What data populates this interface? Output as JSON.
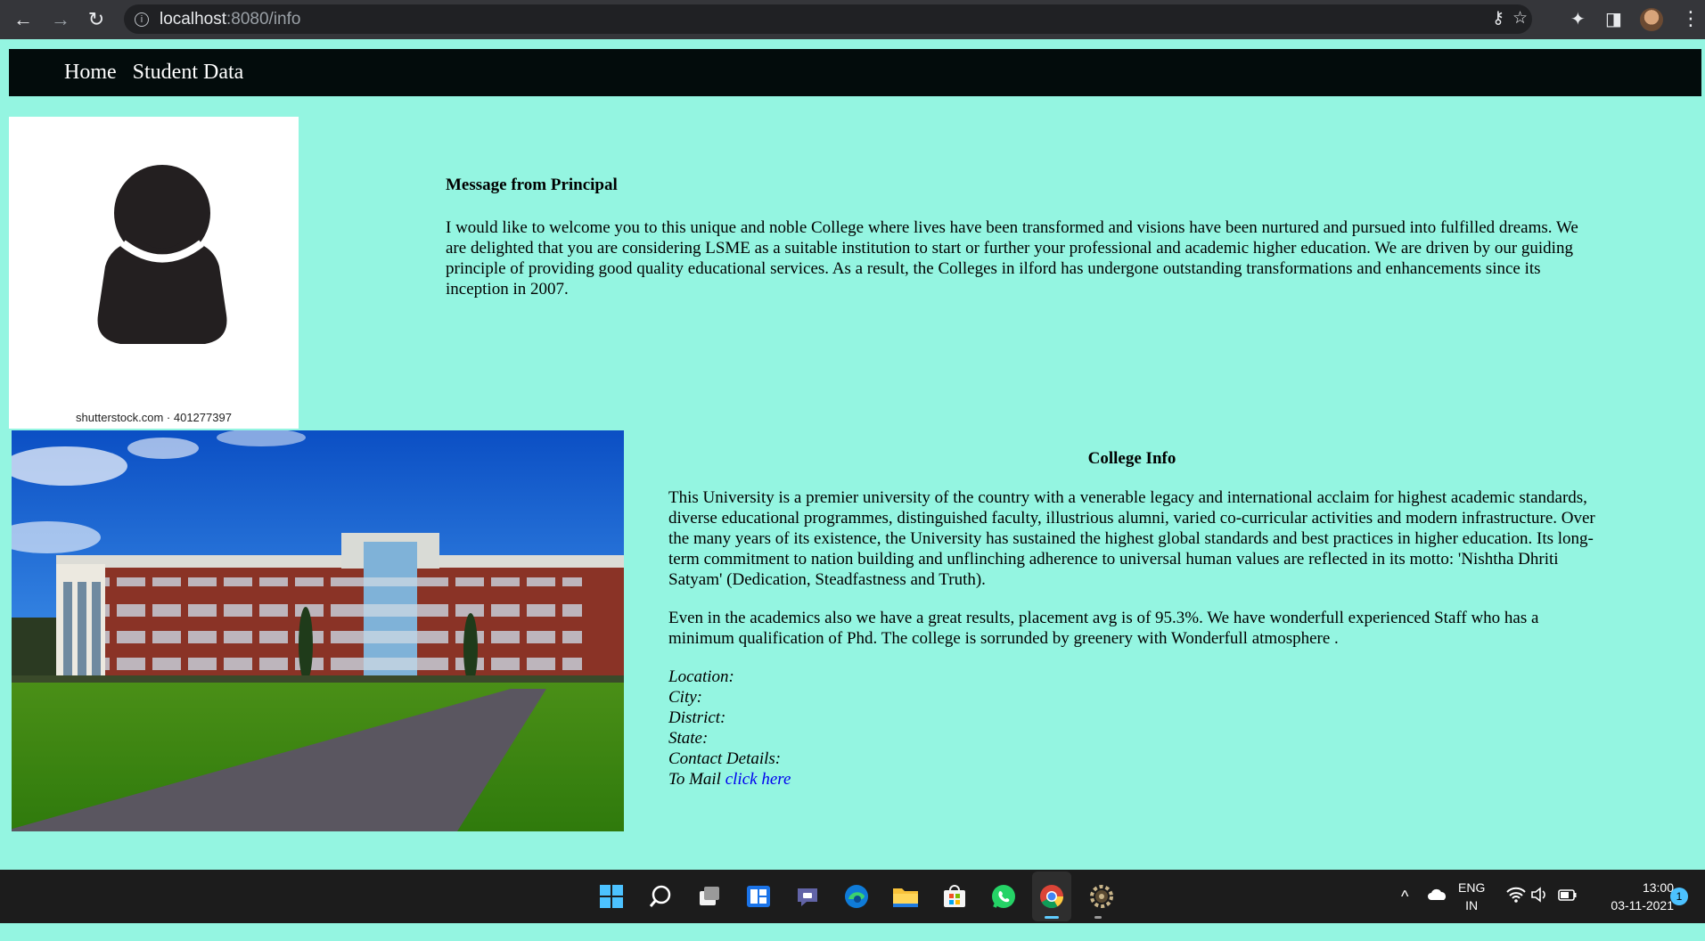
{
  "browser": {
    "url_host": "localhost",
    "url_path": ":8080/info",
    "back_icon": "←",
    "forward_icon": "→",
    "reload_icon": "↻",
    "info_icon": "i",
    "key_icon": "⚷",
    "star_icon": "☆",
    "extensions_icon": "✦",
    "sidepanel_icon": "◨",
    "menu_icon": "⋮"
  },
  "navbar": {
    "links": [
      {
        "label": "Home"
      },
      {
        "label": "Student Data"
      }
    ],
    "background": "#030c0c"
  },
  "page": {
    "background": "#94f5e1",
    "avatar_watermark": "shutterstock.com · 401277397",
    "principal": {
      "heading": "Message from Principal",
      "text": "I would like to welcome you to this unique and noble College where lives have been transformed and visions have been nurtured and pursued into fulfilled dreams. We are delighted that you are considering LSME as a suitable institution to start or further your professional and academic higher education. We are driven by our guiding principle of providing good quality educational services. As a result, the Colleges in ilford has undergone outstanding transformations and enhancements since its inception in 2007."
    },
    "college": {
      "heading": "College Info",
      "paragraph1": "This University is a premier university of the country with a venerable legacy and international acclaim for highest academic standards, diverse educational programmes, distinguished faculty, illustrious alumni, varied co-curricular activities and modern infrastructure. Over the many years of its existence, the University has sustained the highest global standards and best practices in higher education. Its long-term commitment to nation building and unflinching adherence to universal human values are reflected in its motto: 'Nishtha Dhriti Satyam' (Dedication, Steadfastness and Truth).",
      "paragraph2": "Even in the academics also we have a great results, placement avg is of 95.3%. We have wonderfull experienced Staff who has a minimum qualification of Phd. The college is sorrunded by greenery with Wonderfull atmosphere .",
      "location_label": "Location:",
      "city_label": "City:",
      "district_label": "District:",
      "state_label": "State:",
      "contact_label": "Contact Details:",
      "mail_prefix": "To Mail",
      "mail_link": "click here"
    }
  },
  "taskbar": {
    "apps": [
      {
        "name": "start"
      },
      {
        "name": "search"
      },
      {
        "name": "task-view"
      },
      {
        "name": "widgets"
      },
      {
        "name": "teams-chat"
      },
      {
        "name": "edge"
      },
      {
        "name": "file-explorer"
      },
      {
        "name": "microsoft-store"
      },
      {
        "name": "whatsapp"
      },
      {
        "name": "chrome"
      },
      {
        "name": "settings"
      }
    ],
    "tray_chevron": "^",
    "lang_line1": "ENG",
    "lang_line2": "IN",
    "time": "13:00",
    "date": "03-11-2021",
    "notification_count": "1"
  }
}
